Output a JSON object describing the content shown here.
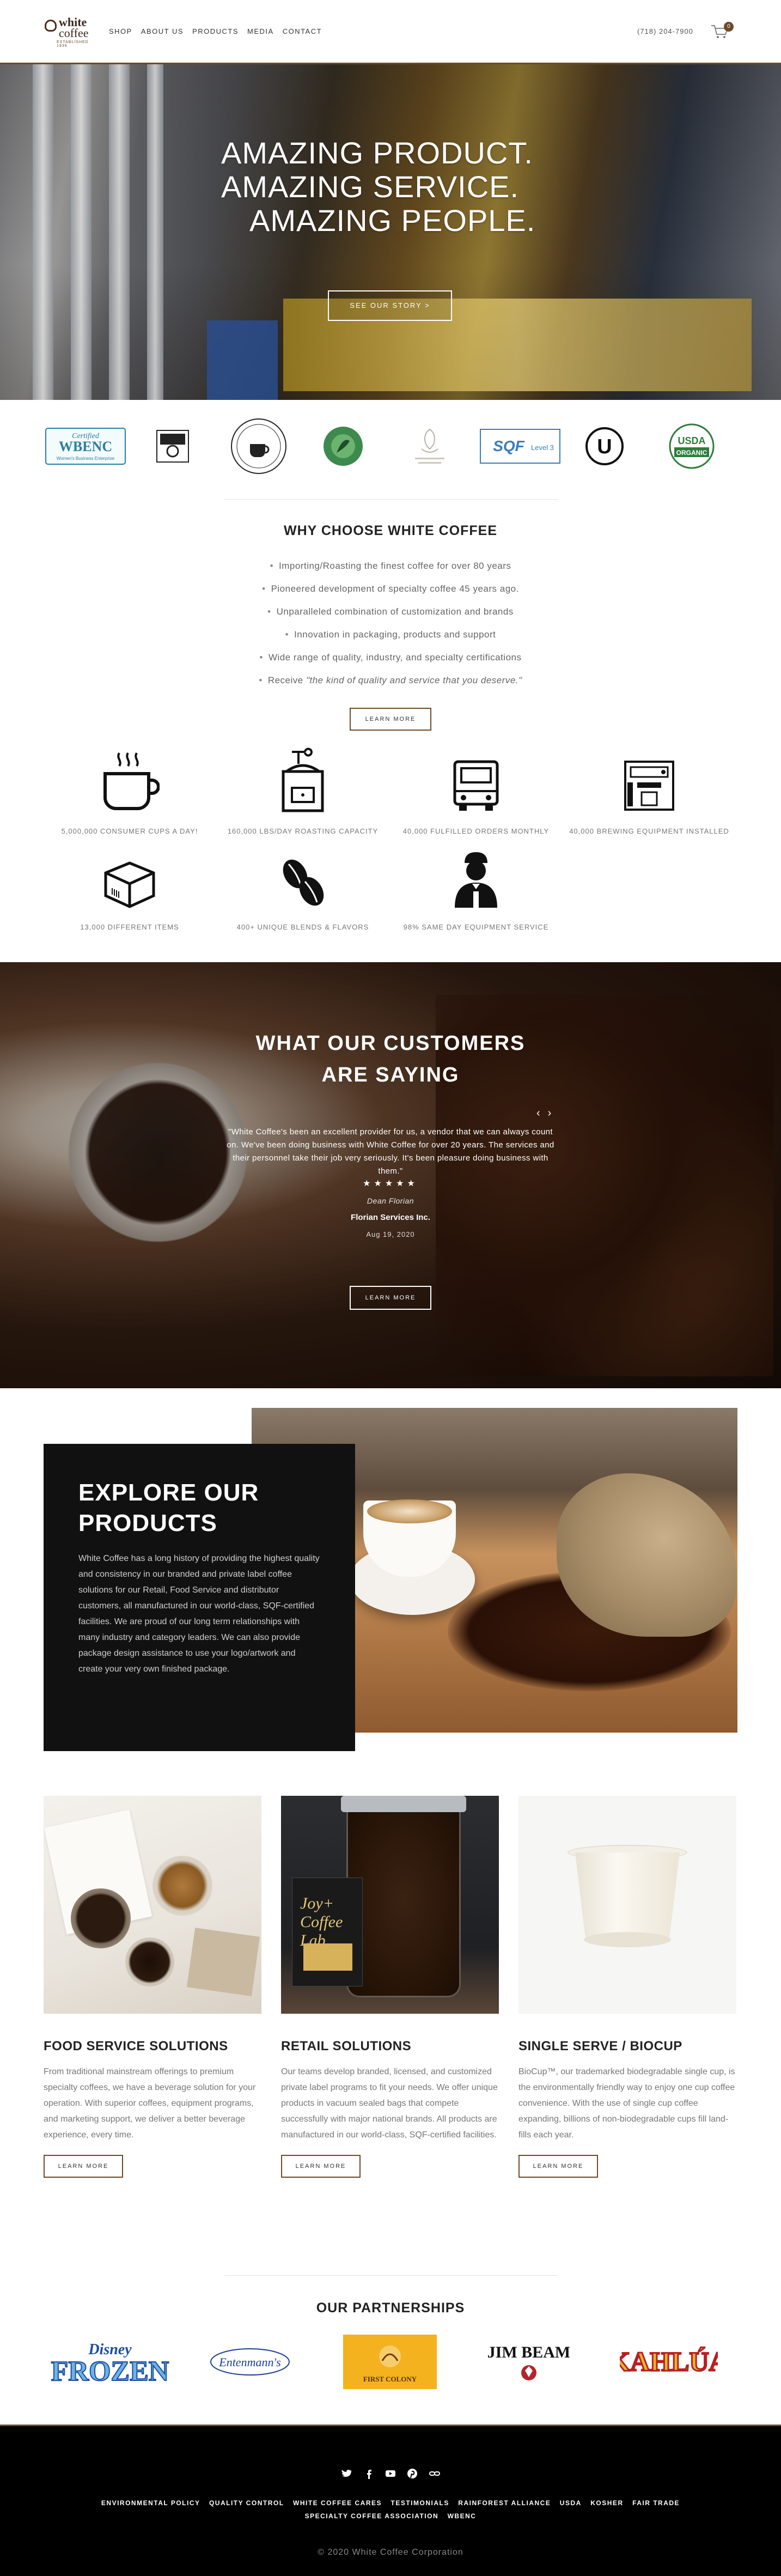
{
  "header": {
    "logo": {
      "line1": "white",
      "line2": "coffee",
      "tagline": "ESTABLISHED 1939"
    },
    "nav": [
      "SHOP",
      "ABOUT US",
      "PRODUCTS",
      "MEDIA",
      "CONTACT"
    ],
    "phone": "(718) 204-7900",
    "cart_count": "0"
  },
  "hero": {
    "lines": [
      "AMAZING PRODUCT.",
      "AMAZING SERVICE.",
      "AMAZING PEOPLE."
    ],
    "button": "SEE OUR STORY >"
  },
  "certifications": {
    "wbenc": {
      "top": "Certified",
      "main": "WBENC",
      "sub": "Women's Business Enterprise"
    },
    "sqf": {
      "main": "SQF",
      "sub": "Level 3"
    },
    "usda": {
      "top": "USDA",
      "sub": "ORGANIC"
    },
    "kosher": "U"
  },
  "why": {
    "title": "WHY CHOOSE WHITE COFFEE",
    "items": [
      "Importing/Roasting the finest coffee for over 80 years",
      "Pioneered development of specialty coffee 45 years ago.",
      "Unparalleled combination of customization and brands",
      "Innovation in packaging, products and support",
      "Wide range of quality, industry, and specialty certifications"
    ],
    "last_item_prefix": "Receive ",
    "last_item_em": "\"the kind of quality and service that you deserve.\"",
    "button": "LEARN MORE"
  },
  "stats": [
    {
      "icon": "coffee-cup",
      "label": "5,000,000 CONSUMER CUPS A DAY!"
    },
    {
      "icon": "coffee-grinder",
      "label": "160,000 LBS/DAY ROASTING CAPACITY"
    },
    {
      "icon": "delivery-truck",
      "label": "40,000 FULFILLED ORDERS MONTHLY"
    },
    {
      "icon": "espresso-machine",
      "label": "40,000 BREWING EQUIPMENT INSTALLED"
    },
    {
      "icon": "box",
      "label": "13,000 DIFFERENT ITEMS"
    },
    {
      "icon": "coffee-beans",
      "label": "400+ UNIQUE BLENDS & FLAVORS"
    },
    {
      "icon": "barista",
      "label": "98% SAME DAY EQUIPMENT SERVICE"
    }
  ],
  "testimonials": {
    "title": "WHAT OUR CUSTOMERS ARE SAYING",
    "quote": "\"White Coffee's been an excellent provider for us, a vendor that we can always count on. We've been doing business with White Coffee for over 20 years. The services and their personnel take their job very seriously. It's been pleasure doing business with them.\"",
    "stars": "★★★★★",
    "name": "Dean Florian",
    "company": "Florian Services Inc.",
    "date": "Aug 19, 2020",
    "button": "LEARN MORE"
  },
  "explore": {
    "title": "EXPLORE OUR PRODUCTS",
    "text": "White Coffee has a long history of providing the highest quality and consistency in our branded and private label coffee solutions for our Retail, Food Service and distributor customers, all manufactured in our world-class, SQF-certified facilities. We are proud of our long term relationships with many industry and category leaders. We can also provide package design assistance to use your logo/artwork and create your very own finished package."
  },
  "products": [
    {
      "title": "FOOD SERVICE SOLUTIONS",
      "text": "From traditional mainstream offerings to premium specialty coffees, we have a beverage solution for your operation. With superior coffees, equipment programs, and marketing support, we deliver a better beverage experience, every time.",
      "button": "LEARN MORE"
    },
    {
      "title": "RETAIL SOLUTIONS",
      "text": "Our teams develop branded, licensed, and customized private label programs to fit your needs. We offer unique products in vacuum sealed bags that compete successfully with major national brands. All products are manufactured in our world-class, SQF-certified facilities.",
      "button": "LEARN MORE",
      "jar_label": "Joy+ Coffee Lab"
    },
    {
      "title": "SINGLE SERVE / BIOCUP",
      "text": "BioCup™, our trademarked biodegradable single cup, is the environmentally friendly way to enjoy one cup coffee convenience. With the use of single cup coffee expanding, billions of non-biodegradable cups fill land-fills each year.",
      "button": "LEARN MORE"
    }
  ],
  "partners": {
    "title": "OUR PARTNERSHIPS",
    "items": [
      {
        "name": "FROZEN",
        "top": "Disney"
      },
      {
        "name": "Entenmann's"
      },
      {
        "name": "FIRST COLONY"
      },
      {
        "name": "JIM BEAM"
      },
      {
        "name": "KAHLÚA"
      }
    ]
  },
  "footer": {
    "social_icons": [
      "twitter-icon",
      "facebook-icon",
      "youtube-icon",
      "pinterest-icon",
      "link-icon"
    ],
    "links_row1": [
      "ENVIRONMENTAL POLICY",
      "QUALITY CONTROL",
      "WHITE COFFEE CARES",
      "TESTIMONIALS",
      "RAINFOREST ALLIANCE",
      "USDA",
      "KOSHER",
      "FAIR TRADE"
    ],
    "links_row2": [
      "SPECIALTY COFFEE ASSOCIATION",
      "WBENC"
    ],
    "copyright": "© 2020 White Coffee Corporation"
  },
  "colors": {
    "accent": "#6b4b2a",
    "footer_bg": "#000000",
    "text": "#333333"
  }
}
